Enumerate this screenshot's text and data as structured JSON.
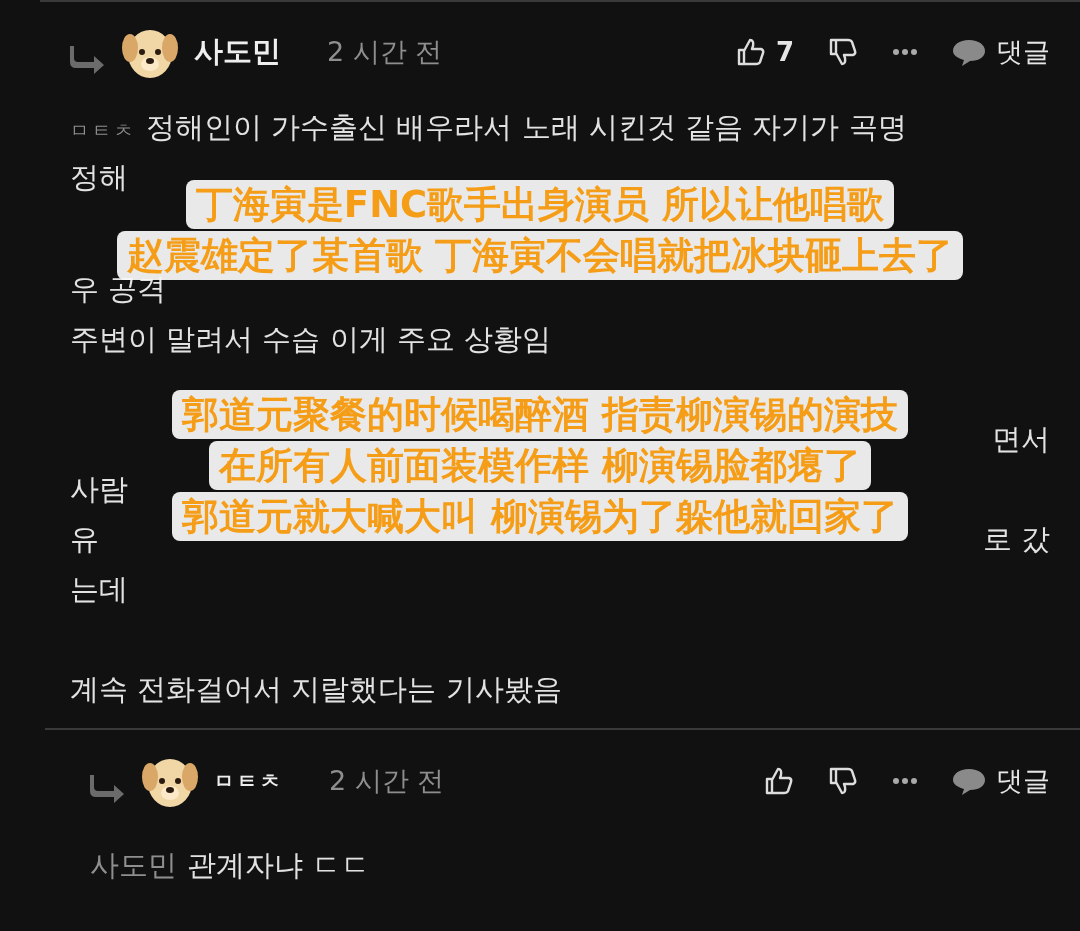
{
  "comments": [
    {
      "author": "사도민",
      "author_bold": true,
      "time": "2 시간 전",
      "likes": "7",
      "reply_label": "댓글",
      "mention": "ㅁㅌㅊ",
      "lines": [
        {
          "kind": "text",
          "left": "정해인이 가수출신 배우라서 노래 시킨것 같음 자기가 곡명"
        },
        {
          "kind": "text",
          "left": "정해"
        },
        {
          "kind": "blank"
        },
        {
          "kind": "text",
          "left": "우 공격"
        },
        {
          "kind": "text",
          "left": "주변이 말려서 수습 이게 주요 상황임"
        },
        {
          "kind": "blank"
        },
        {
          "kind": "text",
          "right": "면서"
        },
        {
          "kind": "text",
          "left": "사람"
        },
        {
          "kind": "text",
          "left": "유",
          "right": "로 갔"
        },
        {
          "kind": "text",
          "left": "는데"
        },
        {
          "kind": "blank"
        },
        {
          "kind": "text",
          "left": "계속 전화걸어서 지랄했다는 기사봤음"
        }
      ]
    },
    {
      "author": "ㅁㅌㅊ",
      "author_bold": true,
      "time": "2 시간 전",
      "reply_label": "댓글",
      "mention": "사도민",
      "lines": [
        {
          "kind": "text",
          "left": "관계자냐 ㄷㄷ"
        }
      ]
    }
  ],
  "subtitles": [
    {
      "lines": [
        "丁海寅是FNC歌手出身演员 所以让他唱歌",
        "赵震雄定了某首歌 丁海寅不会唱就把冰块砸上去了"
      ]
    },
    {
      "lines": [
        "郭道元聚餐的时候喝醉酒 指责柳演锡的演技",
        "在所有人前面装模作样 柳演锡脸都瘪了",
        "郭道元就大喊大叫 柳演锡为了躲他就回家了"
      ]
    }
  ]
}
